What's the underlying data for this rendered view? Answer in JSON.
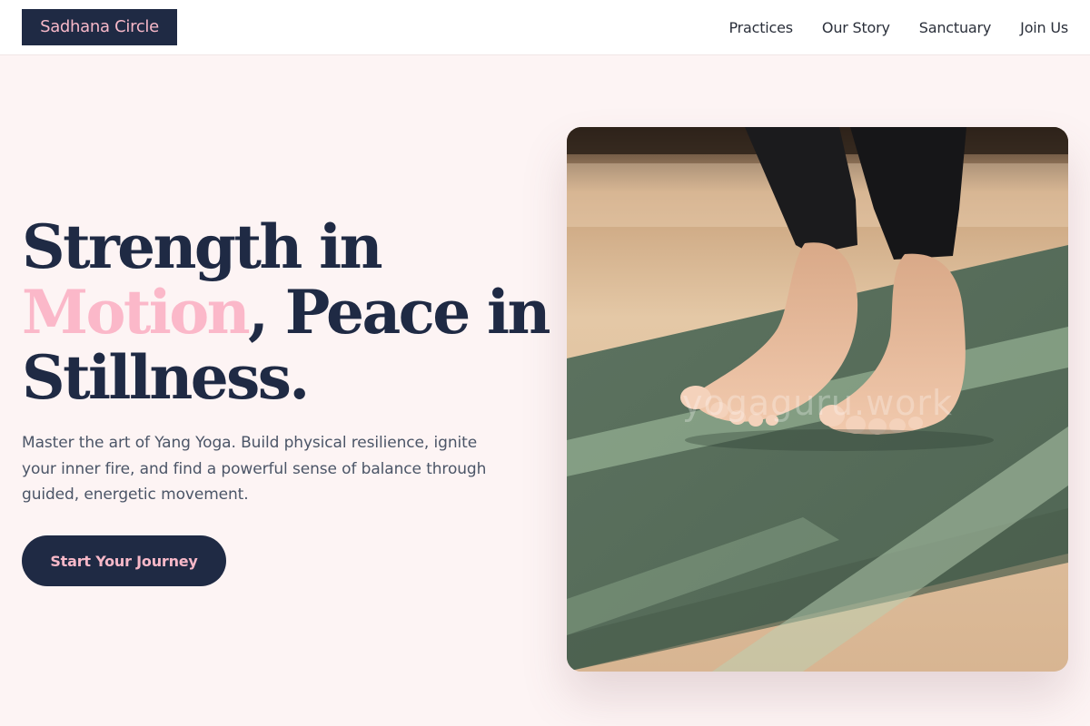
{
  "header": {
    "logo": "Sadhana Circle",
    "nav": [
      "Practices",
      "Our Story",
      "Sanctuary",
      "Join Us"
    ]
  },
  "hero": {
    "headline_line1": "Strength in",
    "headline_accent": "Motion",
    "headline_after_accent": ", Peace in",
    "headline_line3": "Stillness.",
    "subtext": "Master the art of Yang Yoga. Build physical resilience, ignite your inner fire, and find a powerful sense of balance through guided, energetic movement.",
    "cta_label": "Start Your Journey",
    "image_watermark": "yogaguru.work"
  },
  "colors": {
    "navy": "#1f2a44",
    "pink_accent": "#fbb8c9",
    "page_background": "#fdf4f4",
    "mat_green": "#5c725f"
  },
  "icons": []
}
